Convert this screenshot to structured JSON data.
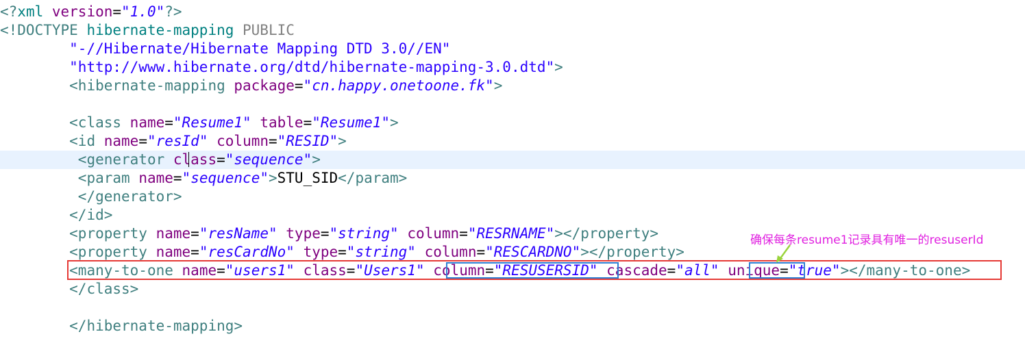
{
  "editor": {
    "lines": [
      {
        "parts": [
          [
            "pi",
            "<?"
          ],
          [
            "dt",
            "xml "
          ],
          [
            "attr",
            "version"
          ],
          [
            "txt",
            "="
          ],
          [
            "val",
            "\"1.0\""
          ],
          [
            "pi",
            "?>"
          ]
        ]
      },
      {
        "parts": [
          [
            "tag",
            "<!DOCTYPE "
          ],
          [
            "dt",
            "hibernate-mapping "
          ],
          [
            "kw",
            "PUBLIC"
          ]
        ]
      },
      {
        "parts": [
          [
            "txt",
            "        "
          ],
          [
            "str",
            "\"-//Hibernate/Hibernate Mapping DTD 3.0//EN\""
          ]
        ]
      },
      {
        "parts": [
          [
            "txt",
            "        "
          ],
          [
            "str",
            "\"http://www.hibernate.org/dtd/hibernate-mapping-3.0.dtd\""
          ],
          [
            "tag",
            ">"
          ]
        ]
      },
      {
        "parts": [
          [
            "txt",
            "        "
          ],
          [
            "tag",
            "<hibernate-mapping "
          ],
          [
            "attr",
            "package"
          ],
          [
            "txt",
            "="
          ],
          [
            "val",
            "\"cn.happy.onetoone.fk\""
          ],
          [
            "tag",
            ">"
          ]
        ]
      },
      {
        "parts": []
      },
      {
        "parts": [
          [
            "txt",
            "        "
          ],
          [
            "tag",
            "<class "
          ],
          [
            "attr",
            "name"
          ],
          [
            "txt",
            "="
          ],
          [
            "val",
            "\"Resume1\""
          ],
          [
            "txt",
            " "
          ],
          [
            "attr",
            "table"
          ],
          [
            "txt",
            "="
          ],
          [
            "val",
            "\"Resume1\""
          ],
          [
            "tag",
            ">"
          ]
        ]
      },
      {
        "parts": [
          [
            "txt",
            "        "
          ],
          [
            "tag",
            "<id "
          ],
          [
            "attr",
            "name"
          ],
          [
            "txt",
            "="
          ],
          [
            "val",
            "\"resId\""
          ],
          [
            "txt",
            " "
          ],
          [
            "attr",
            "column"
          ],
          [
            "txt",
            "="
          ],
          [
            "val",
            "\"RESID\""
          ],
          [
            "tag",
            ">"
          ]
        ]
      },
      {
        "parts": [
          [
            "txt",
            "         "
          ],
          [
            "tag",
            "<generator "
          ],
          [
            "attr",
            "class"
          ],
          [
            "txt",
            "="
          ],
          [
            "val",
            "\"sequence\""
          ],
          [
            "tag",
            ">"
          ]
        ],
        "current": true
      },
      {
        "parts": [
          [
            "txt",
            "         "
          ],
          [
            "tag",
            "<param "
          ],
          [
            "attr",
            "name"
          ],
          [
            "txt",
            "="
          ],
          [
            "val",
            "\"sequence\""
          ],
          [
            "tag",
            ">"
          ],
          [
            "txt",
            "STU_SID"
          ],
          [
            "tag",
            "</param>"
          ]
        ]
      },
      {
        "parts": [
          [
            "txt",
            "         "
          ],
          [
            "tag",
            "</generator>"
          ]
        ]
      },
      {
        "parts": [
          [
            "txt",
            "        "
          ],
          [
            "tag",
            "</id>"
          ]
        ]
      },
      {
        "parts": [
          [
            "txt",
            "        "
          ],
          [
            "tag",
            "<property "
          ],
          [
            "attr",
            "name"
          ],
          [
            "txt",
            "="
          ],
          [
            "val",
            "\"resName\""
          ],
          [
            "txt",
            " "
          ],
          [
            "attr",
            "type"
          ],
          [
            "txt",
            "="
          ],
          [
            "val",
            "\"string\""
          ],
          [
            "txt",
            " "
          ],
          [
            "attr",
            "column"
          ],
          [
            "txt",
            "="
          ],
          [
            "val",
            "\"RESRNAME\""
          ],
          [
            "tag",
            "></property>"
          ]
        ]
      },
      {
        "parts": [
          [
            "txt",
            "        "
          ],
          [
            "tag",
            "<property "
          ],
          [
            "attr",
            "name"
          ],
          [
            "txt",
            "="
          ],
          [
            "val",
            "\"resCardNo\""
          ],
          [
            "txt",
            " "
          ],
          [
            "attr",
            "type"
          ],
          [
            "txt",
            "="
          ],
          [
            "val",
            "\"string\""
          ],
          [
            "txt",
            " "
          ],
          [
            "attr",
            "column"
          ],
          [
            "txt",
            "="
          ],
          [
            "val",
            "\"RESCARDNO\""
          ],
          [
            "tag",
            "></property>"
          ]
        ]
      },
      {
        "parts": [
          [
            "txt",
            "        "
          ],
          [
            "tag",
            "<many-to-one "
          ],
          [
            "attr",
            "name"
          ],
          [
            "txt",
            "="
          ],
          [
            "val",
            "\"users1\""
          ],
          [
            "txt",
            " "
          ],
          [
            "attr",
            "class"
          ],
          [
            "txt",
            "="
          ],
          [
            "val",
            "\"Users1\""
          ],
          [
            "txt",
            " "
          ],
          [
            "attr",
            "column"
          ],
          [
            "txt",
            "="
          ],
          [
            "val",
            "\"RESUSERSID\""
          ],
          [
            "txt",
            " "
          ],
          [
            "attr",
            "cascade"
          ],
          [
            "txt",
            "="
          ],
          [
            "val",
            "\"all\""
          ],
          [
            "txt",
            " "
          ],
          [
            "attr",
            "unique"
          ],
          [
            "txt",
            "="
          ],
          [
            "val",
            "\"true\""
          ],
          [
            "tag",
            "></many-to-one>"
          ]
        ]
      },
      {
        "parts": [
          [
            "txt",
            "        "
          ],
          [
            "tag",
            "</class>"
          ]
        ]
      },
      {
        "parts": []
      },
      {
        "parts": [
          [
            "txt",
            "        "
          ],
          [
            "tag",
            "</hibernate-mapping>"
          ]
        ]
      }
    ]
  },
  "annotation": {
    "text": "确保每条resume1记录具有唯一的resuserId",
    "color": "#e020e0"
  },
  "colors": {
    "highlight_red": "#e53935",
    "highlight_blue": "#2d7fd3",
    "current_line": "#e8f2fe"
  }
}
